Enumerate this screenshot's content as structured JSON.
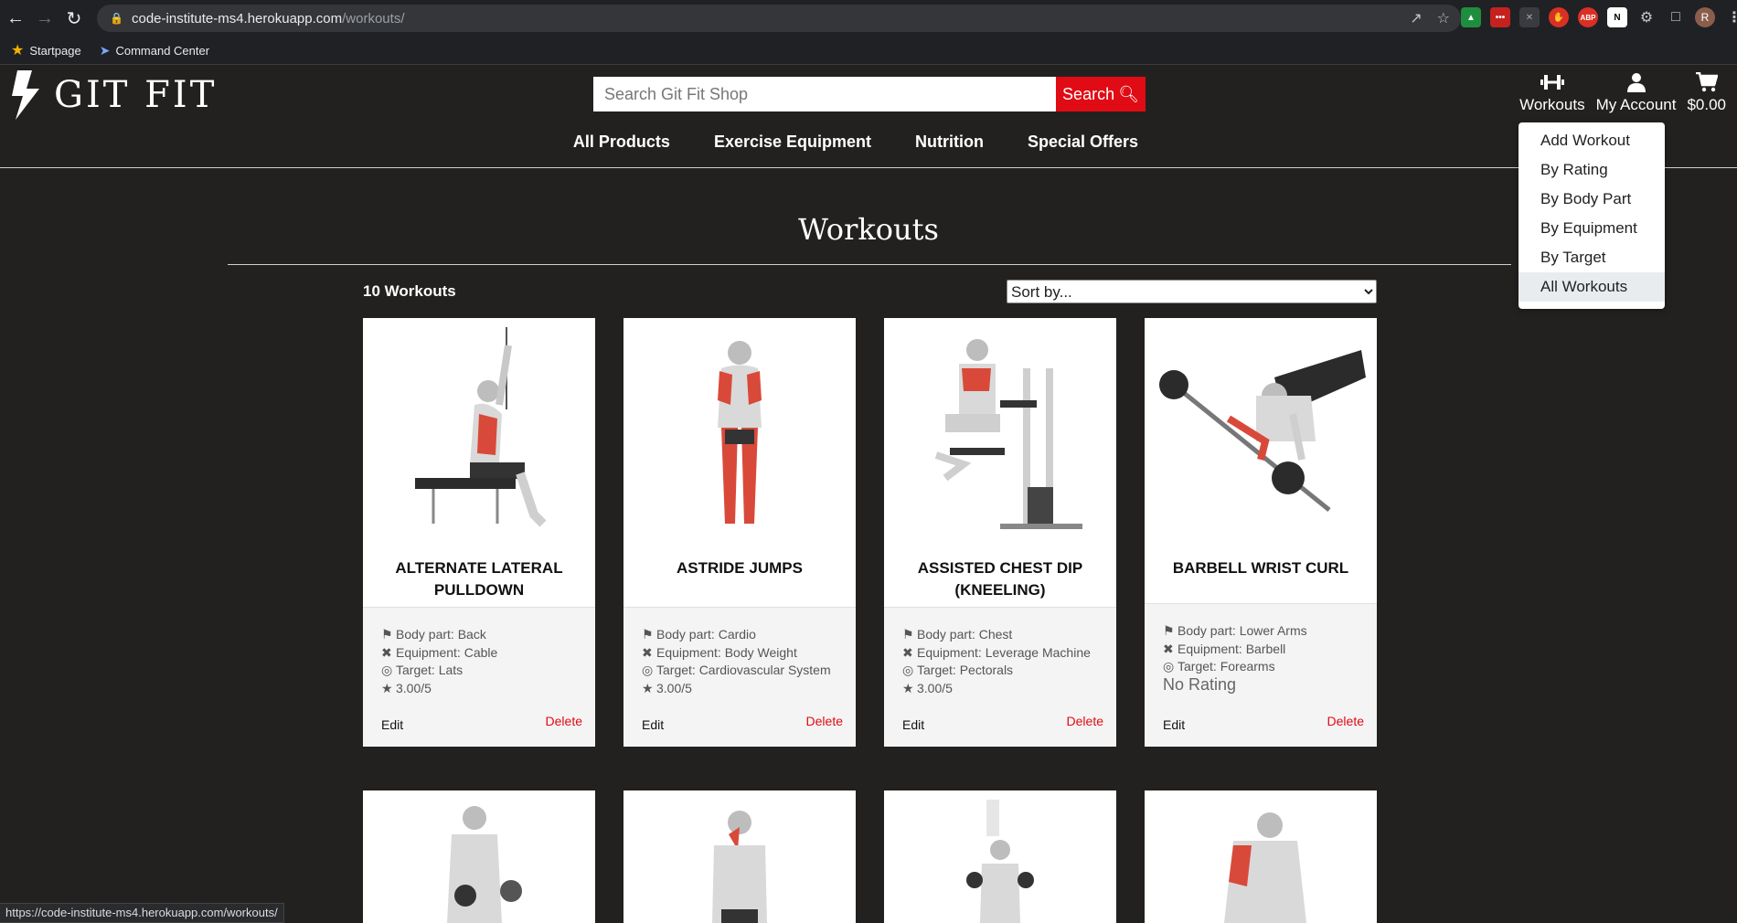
{
  "browser": {
    "url_host": "code-institute-ms4.herokuapp.com",
    "url_path": "/workouts/",
    "bookmarks": [
      {
        "label": "Startpage",
        "icon": "star-icon"
      },
      {
        "label": "Command Center",
        "icon": "rocket-icon"
      }
    ],
    "profile_initial": "R",
    "status_url": "https://code-institute-ms4.herokuapp.com/workouts/"
  },
  "site": {
    "logo_text": "GIT FIT",
    "search_placeholder": "Search Git Fit Shop",
    "search_label": "Search",
    "header_icons": {
      "workouts": "Workouts",
      "account": "My Account",
      "cart": "$0.00"
    },
    "nav": [
      "All Products",
      "Exercise Equipment",
      "Nutrition",
      "Special Offers"
    ],
    "accent_color": "#e00b14"
  },
  "dropdown": {
    "items": [
      "Add Workout",
      "By Rating",
      "By Body Part",
      "By Equipment",
      "By Target",
      "All Workouts"
    ],
    "active_index": 5
  },
  "page": {
    "title": "Workouts",
    "count": "10 Workouts",
    "sort_placeholder": "Sort by..."
  },
  "cards": [
    {
      "name": "ALTERNATE LATERAL PULLDOWN",
      "body_part": "Body part: Back",
      "equipment": "Equipment: Cable",
      "target": "Target: Lats",
      "rating": "3.00/5",
      "edit": "Edit",
      "delete": "Delete"
    },
    {
      "name": "ASTRIDE JUMPS",
      "body_part": "Body part: Cardio",
      "equipment": "Equipment: Body Weight",
      "target": "Target: Cardiovascular System",
      "rating": "3.00/5",
      "edit": "Edit",
      "delete": "Delete"
    },
    {
      "name": "ASSISTED CHEST DIP (KNEELING)",
      "body_part": "Body part: Chest",
      "equipment": "Equipment: Leverage Machine",
      "target": "Target: Pectorals",
      "rating": "3.00/5",
      "edit": "Edit",
      "delete": "Delete"
    },
    {
      "name": "BARBELL WRIST CURL",
      "body_part": "Body part: Lower Arms",
      "equipment": "Equipment: Barbell",
      "target": "Target: Forearms",
      "rating": "No Rating",
      "edit": "Edit",
      "delete": "Delete"
    }
  ]
}
